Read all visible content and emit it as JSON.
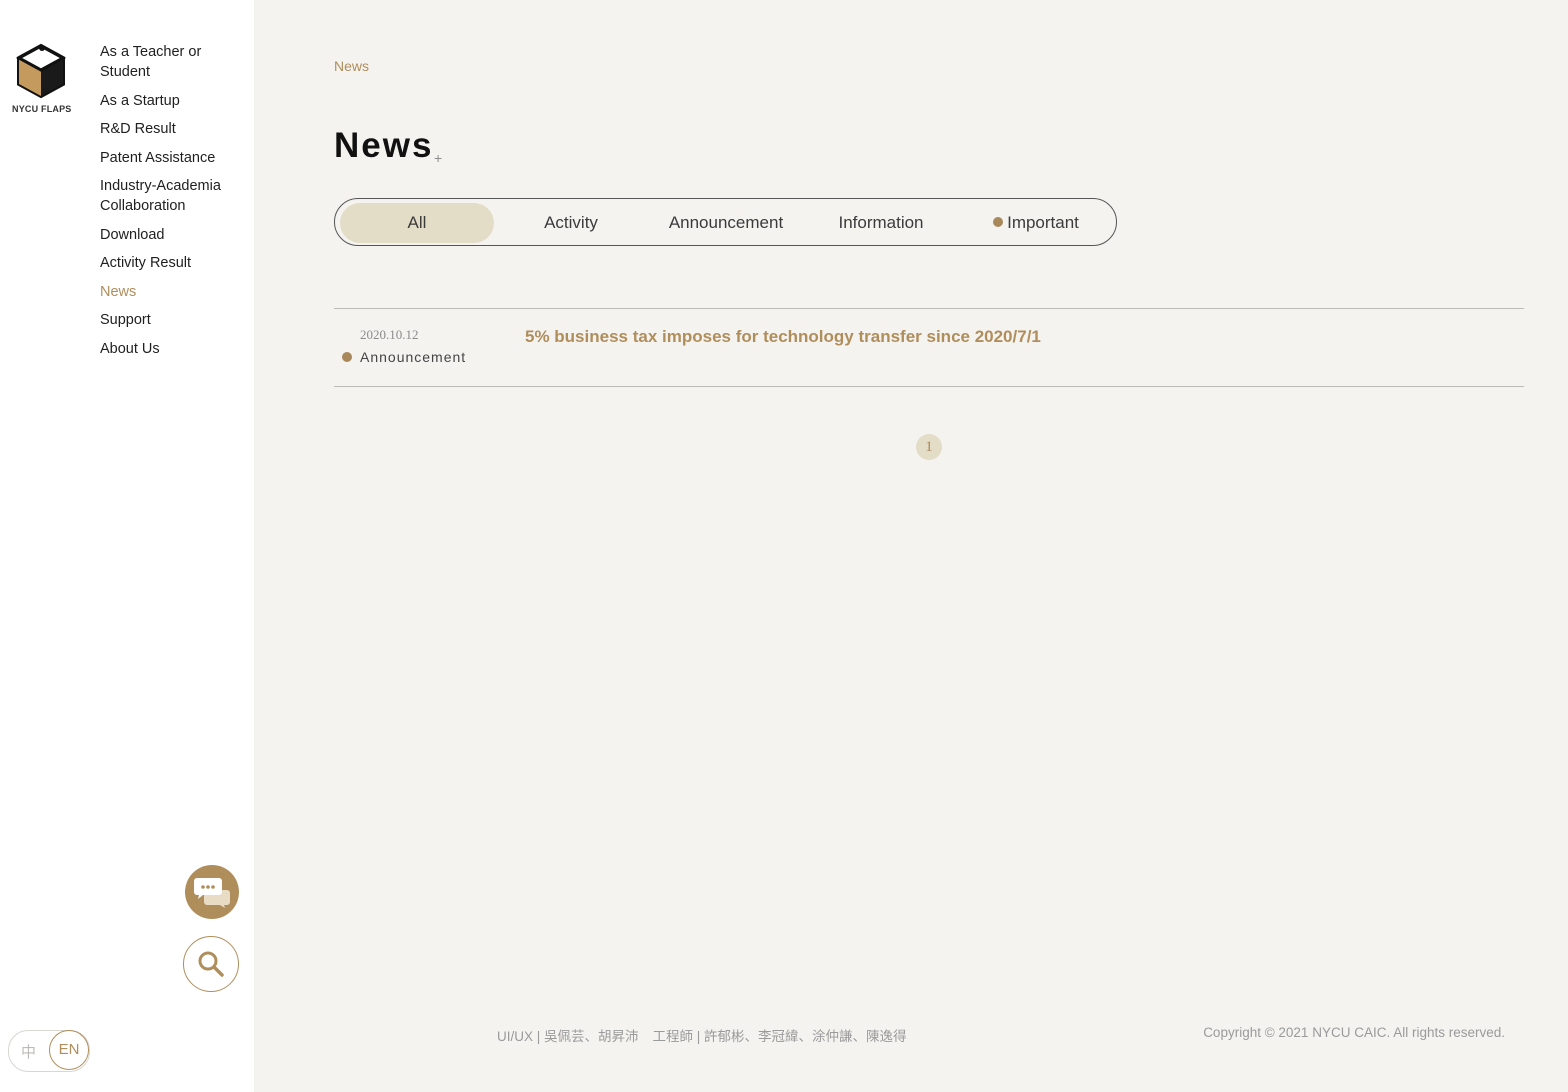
{
  "brand": {
    "name": "NYCU FLAPS",
    "accent_color": "#b08e5c",
    "tab_active_color": "#e3dcc6"
  },
  "sidebar": {
    "items": [
      {
        "label": "As a Teacher or Student",
        "active": false
      },
      {
        "label": "As a Startup",
        "active": false
      },
      {
        "label": "R&D Result",
        "active": false
      },
      {
        "label": "Patent Assistance",
        "active": false
      },
      {
        "label": "Industry-Academia Collaboration",
        "active": false
      },
      {
        "label": "Download",
        "active": false
      },
      {
        "label": "Activity Result",
        "active": false
      },
      {
        "label": "News",
        "active": true
      },
      {
        "label": "Support",
        "active": false
      },
      {
        "label": "About Us",
        "active": false
      }
    ],
    "chat_icon": "chat-bubbles-icon",
    "search_icon": "search-icon",
    "language": {
      "zh": "中",
      "en": "EN",
      "selected": "EN"
    }
  },
  "main": {
    "breadcrumb": "News",
    "title": "News",
    "title_plus": "+",
    "filters": [
      {
        "label": "All",
        "active": true
      },
      {
        "label": "Activity",
        "active": false
      },
      {
        "label": "Announcement",
        "active": false
      },
      {
        "label": "Information",
        "active": false
      },
      {
        "label": "Important",
        "active": false
      }
    ],
    "news": [
      {
        "date": "2020.10.12",
        "category": "Announcement",
        "title": "5% business tax imposes for technology transfer since 2020/7/1"
      }
    ],
    "pagination": {
      "current_page": "1"
    }
  },
  "footer": {
    "uiux": "UI/UX | 吳佩芸、胡昇沛",
    "engineers": "工程師 | 許郁彬、李冠緯、涂仲謙、陳逸得",
    "copyright": "Copyright © 2021 NYCU CAIC. All rights reserved."
  }
}
